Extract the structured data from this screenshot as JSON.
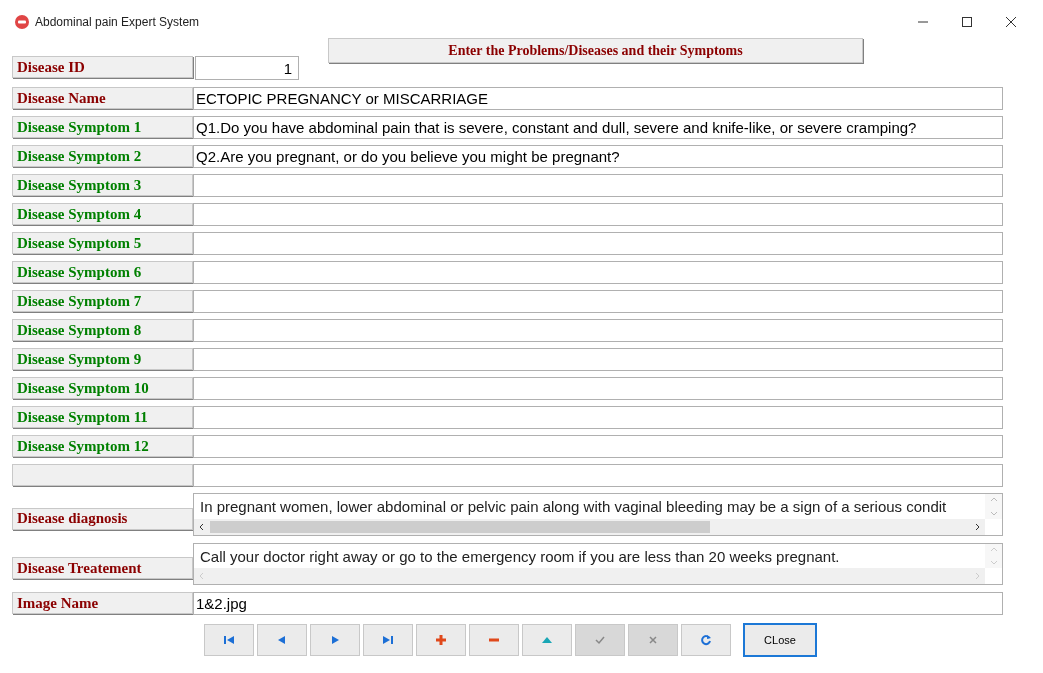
{
  "window": {
    "title": "Abdominal pain Expert System"
  },
  "header": "Enter the Problems/Diseases and their Symptoms",
  "fields": [
    {
      "kind": "id",
      "color": "#8b0000",
      "label": "Disease ID",
      "value": "1"
    },
    {
      "kind": "text",
      "color": "#8b0000",
      "label": "Disease Name",
      "value": "ECTOPIC PREGNANCY or MISCARRIAGE"
    },
    {
      "kind": "text",
      "color": "#008000",
      "label": "Disease Symptom 1",
      "value": "Q1.Do you have abdominal pain that is severe, constant and dull, severe and knife-like, or severe cramping?"
    },
    {
      "kind": "text",
      "color": "#008000",
      "label": "Disease Symptom 2",
      "value": "Q2.Are you pregnant, or do you believe you might be pregnant?"
    },
    {
      "kind": "text",
      "color": "#008000",
      "label": "Disease Symptom 3"
    },
    {
      "kind": "text",
      "color": "#008000",
      "label": "Disease Symptom 4"
    },
    {
      "kind": "text",
      "color": "#008000",
      "label": "Disease Symptom 5"
    },
    {
      "kind": "text",
      "color": "#008000",
      "label": "Disease Symptom 6"
    },
    {
      "kind": "text",
      "color": "#008000",
      "label": "Disease Symptom 7"
    },
    {
      "kind": "text",
      "color": "#008000",
      "label": "Disease Symptom 8"
    },
    {
      "kind": "text",
      "color": "#008000",
      "label": "Disease Symptom 9"
    },
    {
      "kind": "text",
      "color": "#008000",
      "label": "Disease Symptom 10"
    },
    {
      "kind": "text",
      "color": "#008000",
      "label": "Disease Symptom 11"
    },
    {
      "kind": "text",
      "color": "#008000",
      "label": "Disease Symptom 12"
    },
    {
      "kind": "blank"
    },
    {
      "kind": "memo",
      "color": "#8b0000",
      "label": "Disease diagnosis",
      "value": "In pregnant women, lower abdominal or pelvic pain along with vaginal bleeding may be a sign of a serious condit",
      "scroll_enabled": true
    },
    {
      "kind": "memo",
      "color": "#8b0000",
      "label": "Disease Treatement",
      "value": "Call your doctor right away or go to the emergency room if you are less than 20 weeks pregnant.",
      "scroll_enabled": false
    },
    {
      "kind": "text",
      "color": "#8b0000",
      "label": "Image Name",
      "value": "1&2.jpg"
    }
  ],
  "toolbar": [
    {
      "kind": "first",
      "disabled": false
    },
    {
      "kind": "prev",
      "disabled": false
    },
    {
      "kind": "next",
      "disabled": false
    },
    {
      "kind": "last",
      "disabled": false
    },
    {
      "kind": "add",
      "disabled": false
    },
    {
      "kind": "delete",
      "disabled": false
    },
    {
      "kind": "edit",
      "disabled": false
    },
    {
      "kind": "post",
      "disabled": true
    },
    {
      "kind": "cancel",
      "disabled": true
    },
    {
      "kind": "refresh",
      "disabled": false
    }
  ],
  "close_button": {
    "label": "CLose",
    "focused": true
  }
}
